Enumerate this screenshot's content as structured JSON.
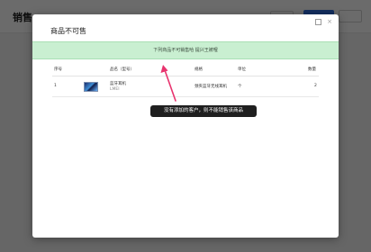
{
  "background": {
    "title": "销售"
  },
  "modal": {
    "title": "商品不可售",
    "close_glyph": "×",
    "banner": "下列商品不可销售哈 提兴王被哩",
    "table": {
      "headers": [
        "序号",
        "品名（型号）",
        "规格",
        "单位",
        "数量"
      ],
      "rows": [
        {
          "index": "1",
          "name": "蓝牙耳机",
          "model": "LMEI",
          "spec": "颈夹蓝牙无线耳机",
          "unit": "个",
          "qty": "2"
        }
      ]
    }
  },
  "tooltip": {
    "text": "没有添加的客户，则不能销售该商品"
  },
  "colors": {
    "banner_bg": "#c9efd1",
    "arrow": "#e8336e",
    "tooltip_bg": "#1f1f1f",
    "primary": "#2f6fe0"
  }
}
